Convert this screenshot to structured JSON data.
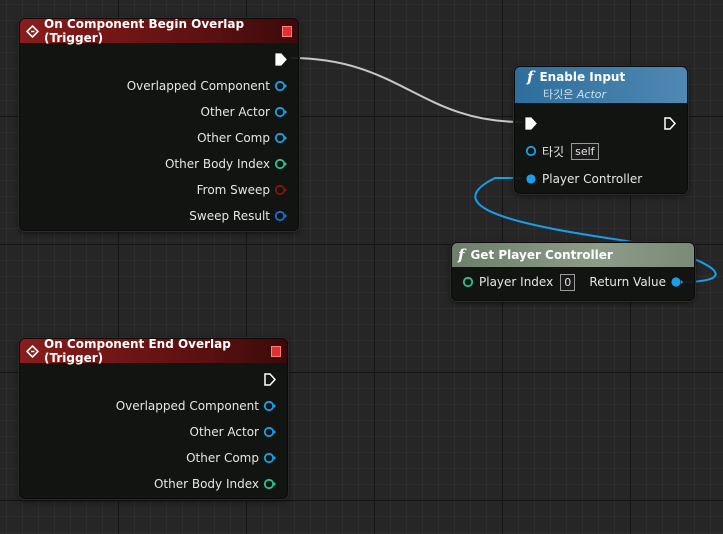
{
  "colors": {
    "exec": "#ffffff",
    "object": "#1aa0e8",
    "integer": "#2ec28c",
    "boolean": "#8a1010",
    "struct": "#1a5fb0",
    "event_header": "#8a1c1c",
    "function_header": "#2e6e9c",
    "pure_header": "#7a8a76"
  },
  "begin_overlap_node": {
    "title": "On Component Begin Overlap (Trigger)",
    "pins": [
      "Overlapped Component",
      "Other Actor",
      "Other Comp",
      "Other Body Index",
      "From Sweep",
      "Sweep Result"
    ]
  },
  "end_overlap_node": {
    "title": "On Component End Overlap (Trigger)",
    "pins": [
      "Overlapped Component",
      "Other Actor",
      "Other Comp",
      "Other Body Index"
    ]
  },
  "enable_input_node": {
    "title": "Enable Input",
    "subtitle_prefix": "타깃은",
    "subtitle_class": "Actor",
    "target_label": "타깃",
    "target_value": "self",
    "player_controller_label": "Player Controller"
  },
  "get_player_controller_node": {
    "title": "Get Player Controller",
    "player_index_label": "Player Index",
    "player_index_value": "0",
    "return_value_label": "Return Value"
  }
}
